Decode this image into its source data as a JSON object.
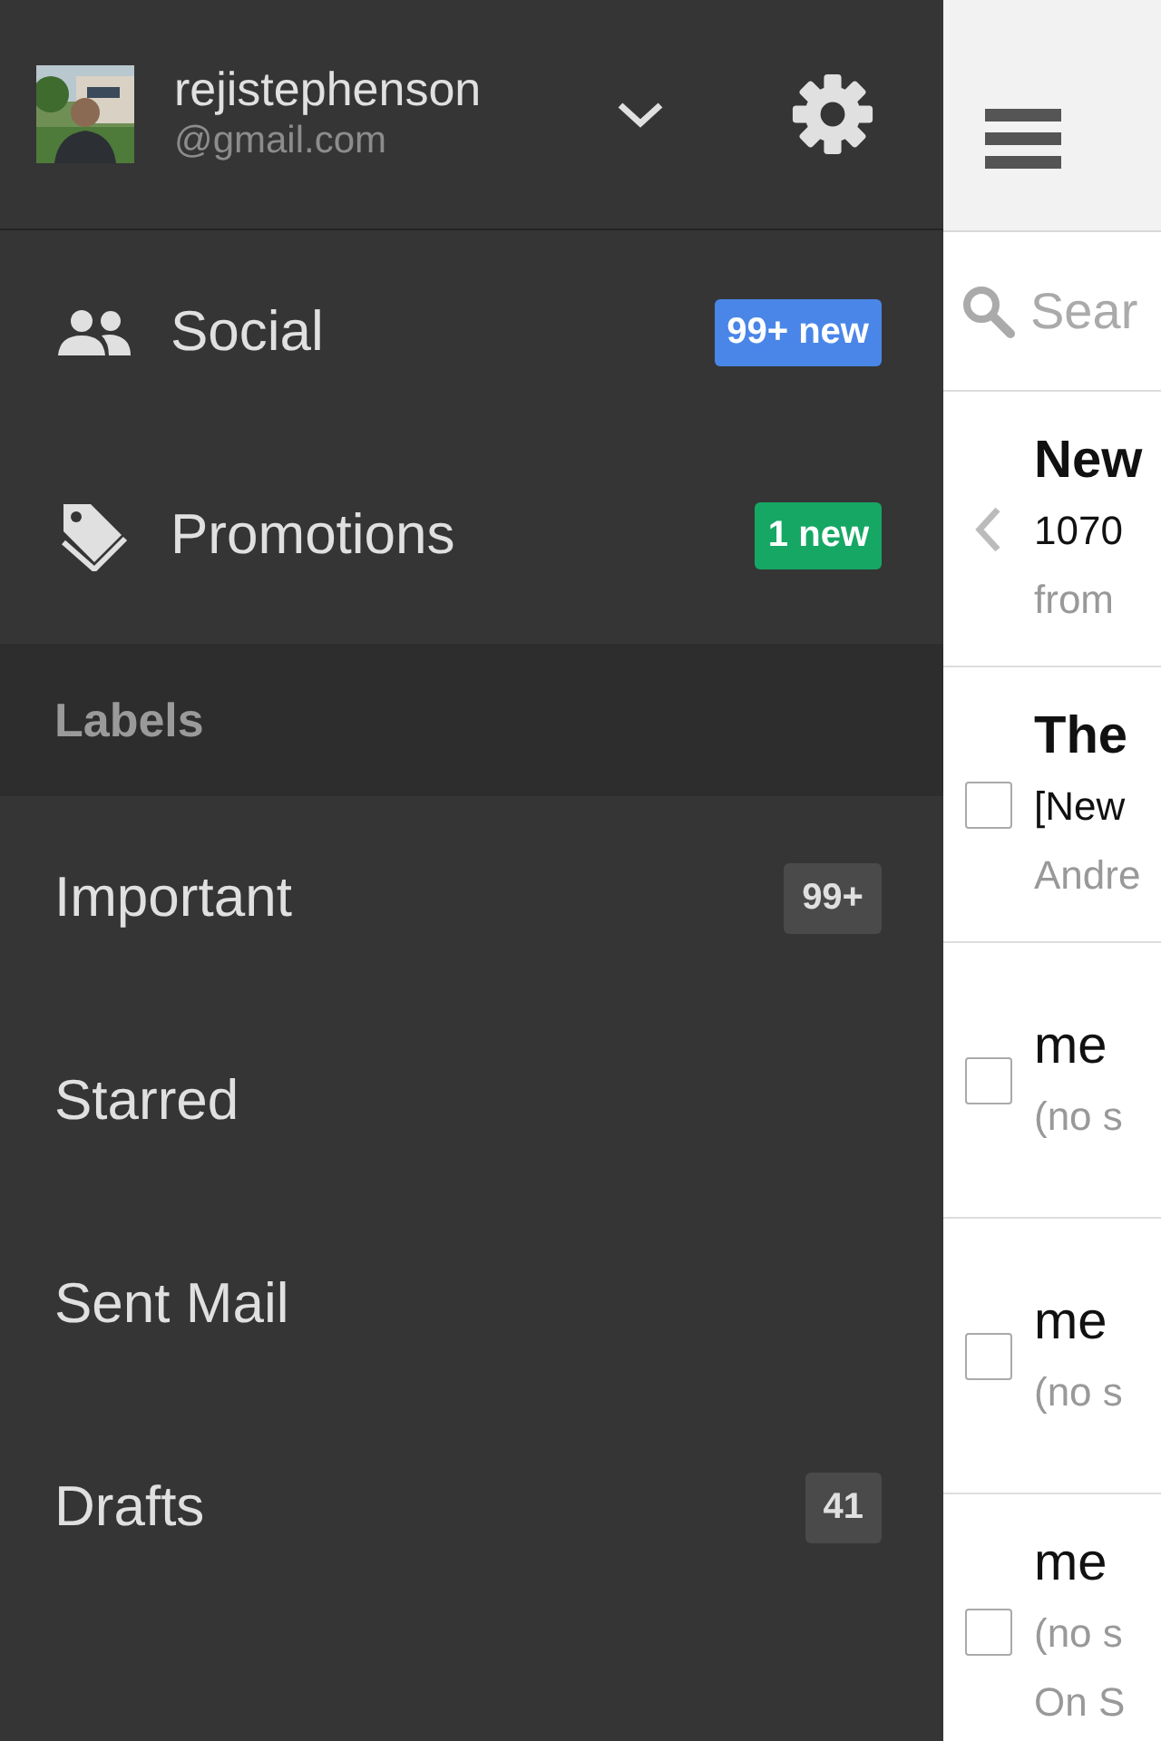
{
  "account": {
    "username": "rejistephenson",
    "email": "@gmail.com"
  },
  "categories": [
    {
      "kind": "social",
      "label": "Social",
      "badge": "99+ new",
      "color": "#4a86e8"
    },
    {
      "kind": "promotions",
      "label": "Promotions",
      "badge": "1 new",
      "color": "#16a765"
    }
  ],
  "labels_heading": "Labels",
  "labels": [
    {
      "label": "Important",
      "count": "99+"
    },
    {
      "label": "Starred"
    },
    {
      "label": "Sent Mail"
    },
    {
      "label": "Drafts",
      "count": "41"
    }
  ],
  "search": {
    "placeholder": "Sear"
  },
  "threads": [
    {
      "kind": "back",
      "unread": true,
      "sender": "New",
      "subject": "1070",
      "snippet": "from"
    },
    {
      "kind": "checkbox",
      "checked": false,
      "unread": true,
      "sender": "The",
      "subject": "[New",
      "snippet": "Andre"
    },
    {
      "kind": "checkbox",
      "checked": false,
      "unread": false,
      "sender": "me",
      "subject": "(no s"
    },
    {
      "kind": "checkbox",
      "checked": false,
      "unread": false,
      "sender": "me",
      "subject": "(no s"
    },
    {
      "kind": "checkbox",
      "checked": false,
      "unread": false,
      "sender": "me",
      "subject": "(no s",
      "snippet": "On S"
    }
  ]
}
